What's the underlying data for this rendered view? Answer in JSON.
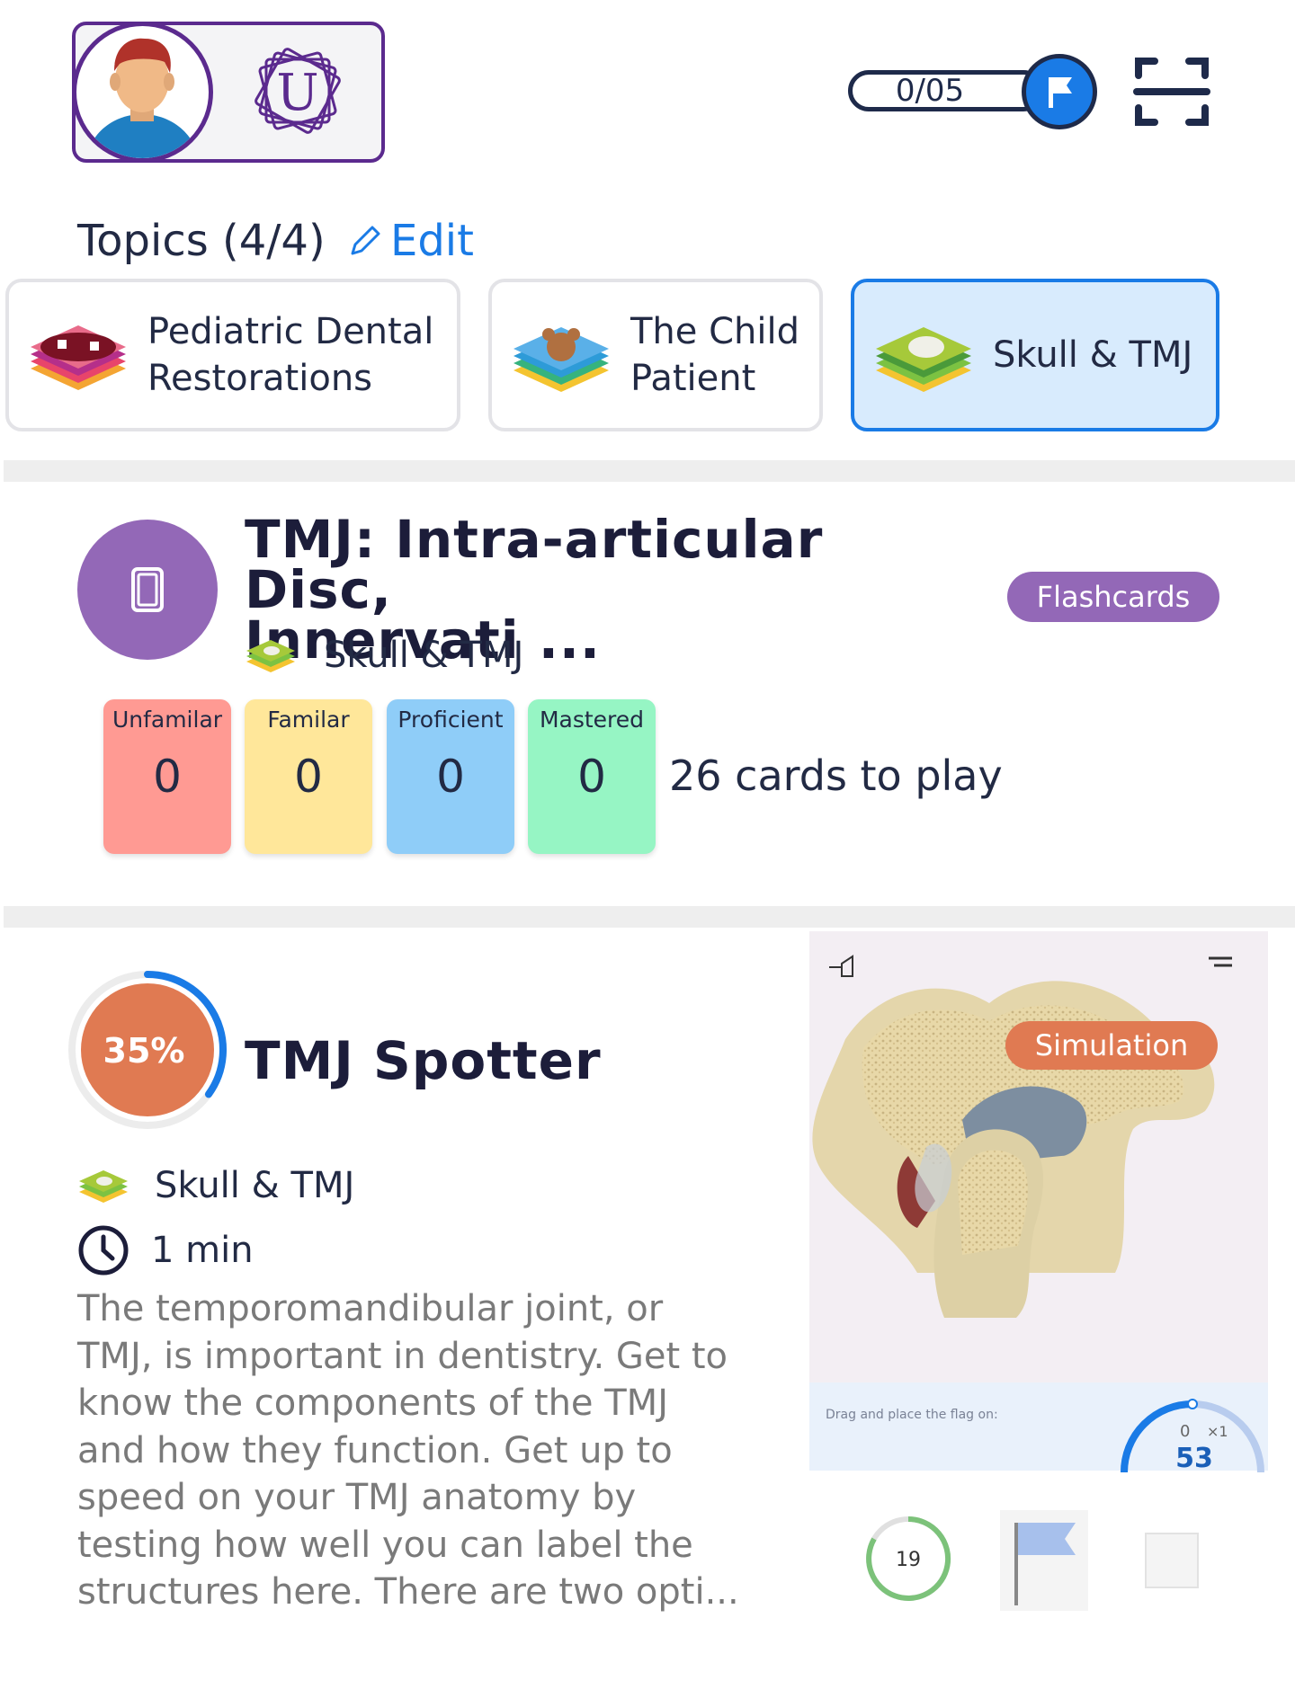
{
  "header": {
    "profile_badge_letter": "U",
    "progress_text": "0/05",
    "flag_icon": "flag-icon",
    "scan_icon": "scan-icon",
    "accent_color": "#5b2a8e",
    "primary_color": "#1a7be6"
  },
  "topics": {
    "title": "Topics (4/4)",
    "edit_label": "Edit",
    "items": [
      {
        "line1": "Pediatric Dental",
        "line2": "Restorations",
        "active": false
      },
      {
        "line1": "The Child",
        "line2": "Patient",
        "active": false
      },
      {
        "line1": "Skull & TMJ",
        "line2": "",
        "active": true
      }
    ]
  },
  "flashcards_item": {
    "title_line1": "TMJ: Intra-articular Disc,",
    "title_line2": "Innervati ...",
    "badge": "Flashcards",
    "topic": "Skull & TMJ",
    "stats": [
      {
        "label": "Unfamilar",
        "value": "0",
        "color": "#ff9a93"
      },
      {
        "label": "Familar",
        "value": "0",
        "color": "#ffe79a"
      },
      {
        "label": "Proficient",
        "value": "0",
        "color": "#8fcdf8"
      },
      {
        "label": "Mastered",
        "value": "0",
        "color": "#96f5c4"
      }
    ],
    "cards_to_play": "26 cards to play"
  },
  "simulation_item": {
    "progress_percent": 35,
    "progress_label": "35%",
    "title": "TMJ Spotter",
    "topic": "Skull & TMJ",
    "duration": "1 min",
    "description": "The temporomandibular joint, or TMJ, is important in dentistry.  Get to know the components of the TMJ and how they function.  Get up to speed on your TMJ anatomy by testing how well you can label the structures here.  There are two opti...",
    "badge": "Simulation",
    "preview": {
      "hint": "Drag and place the flag on:",
      "gauge_value": "53",
      "gauge_tick_left": "0",
      "gauge_tick_right": "×1",
      "timer_value": "19"
    }
  }
}
